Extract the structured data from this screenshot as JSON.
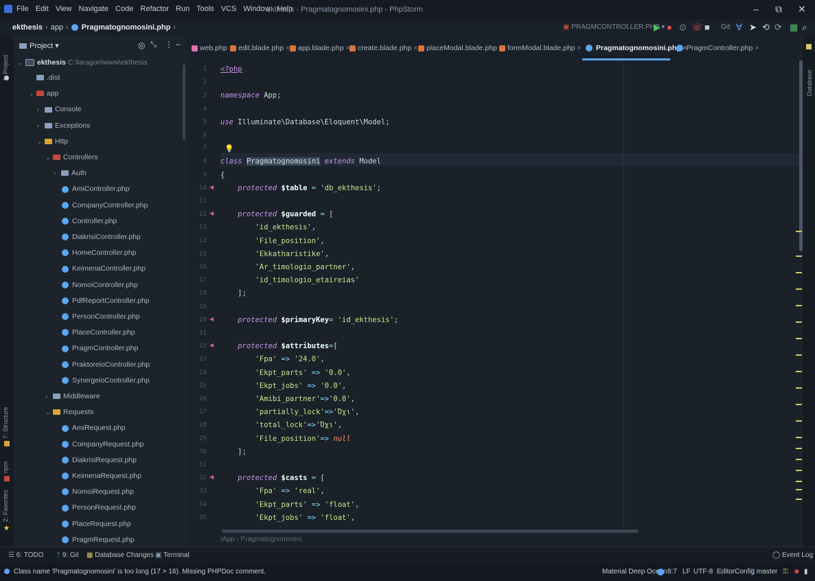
{
  "menu": {
    "items": [
      "File",
      "Edit",
      "View",
      "Navigate",
      "Code",
      "Refactor",
      "Run",
      "Tools",
      "VCS",
      "Window",
      "Help"
    ],
    "window_title": "ekthesis - Pragmatognomosini.php - PhpStorm"
  },
  "breadcrumb": {
    "project": "ekthesis",
    "folder": "app",
    "file": "Pragmatognomosini.php"
  },
  "run_config": "PRAGMCONTROLLER.PHP",
  "toolbar_vcs": "Git:",
  "project_panel": {
    "title": "Project",
    "root": "ekthesis",
    "root_path": "C:\\laragon\\www\\ekthesis",
    "items": [
      {
        "label": ".dist",
        "depth": 1
      },
      {
        "label": "app",
        "depth": 1
      },
      {
        "label": "Console",
        "depth": 2
      },
      {
        "label": "Exceptions",
        "depth": 2
      },
      {
        "label": "Http",
        "depth": 2
      },
      {
        "label": "Controllers",
        "depth": 3
      },
      {
        "label": "Auth",
        "depth": 4
      },
      {
        "label": "AmiController.php",
        "depth": 5
      },
      {
        "label": "CompanyController.php",
        "depth": 5
      },
      {
        "label": "Controller.php",
        "depth": 5
      },
      {
        "label": "DiakrisiController.php",
        "depth": 5
      },
      {
        "label": "HomeController.php",
        "depth": 5
      },
      {
        "label": "KeimenaController.php",
        "depth": 5
      },
      {
        "label": "NomoiController.php",
        "depth": 5
      },
      {
        "label": "PdfReportController.php",
        "depth": 5
      },
      {
        "label": "PersonController.php",
        "depth": 5
      },
      {
        "label": "PlaceController.php",
        "depth": 5
      },
      {
        "label": "PragmController.php",
        "depth": 5
      },
      {
        "label": "PraktoreioController.php",
        "depth": 5
      },
      {
        "label": "SynergeioController.php",
        "depth": 5
      },
      {
        "label": "Middleware",
        "depth": 3
      },
      {
        "label": "Requests",
        "depth": 3
      },
      {
        "label": "AmiRequest.php",
        "depth": 5
      },
      {
        "label": "CompanyRequest.php",
        "depth": 5
      },
      {
        "label": "DiakrisiRequest.php",
        "depth": 5
      },
      {
        "label": "KeimenaRequest.php",
        "depth": 5
      },
      {
        "label": "NomoiRequest.php",
        "depth": 5
      },
      {
        "label": "PersonRequest.php",
        "depth": 5
      },
      {
        "label": "PlaceRequest.php",
        "depth": 5
      },
      {
        "label": "PragmRequest.php",
        "depth": 5
      }
    ]
  },
  "tabs": [
    {
      "label": "web.php",
      "active": false
    },
    {
      "label": "edit.blade.php",
      "active": false
    },
    {
      "label": "app.blade.php",
      "active": false
    },
    {
      "label": "create.blade.php",
      "active": false
    },
    {
      "label": "placeModal.blade.php",
      "active": false
    },
    {
      "label": "formModal.blade.php",
      "active": false
    },
    {
      "label": "Pragmatognomosini.php",
      "active": true
    },
    {
      "label": "PragmController.php",
      "active": false
    }
  ],
  "code_lines": [
    "<?php",
    "",
    "namespace App;",
    "",
    "use Illuminate\\Database\\Eloquent\\Model;",
    "",
    "",
    "class Pragmatognomosini extends Model",
    "{",
    "    protected $table = 'db_ekthesis';",
    "",
    "    protected $guarded = [",
    "        'id_ekthesis',",
    "        'File_position',",
    "        'Ekkatharistike',",
    "        'Ar_timologio_partner',",
    "        'id_timologio_etaireias'",
    "    ];",
    "",
    "    protected $primaryKey= 'id_ekthesis';",
    "",
    "    protected $attributes=[",
    "        'Fpa' => '24.0',",
    "        'Ekpt_parts' => '0.0',",
    "        'Ekpt_jobs' => '0.0',",
    "        'Amibi_partner'=>'0.0',",
    "        'partially_lock'=>'Όχι',",
    "        'total_lock'=>'Όχι',",
    "        'File_position'=> null",
    "    ];",
    "",
    "    protected $casts = [",
    "        'Fpa' => 'real',",
    "        'Ekpt_parts' => 'float',",
    "        'Ekpt_jobs' => 'float',"
  ],
  "editor_breadcrumb": "\\App  ›  Pragmatognomosini",
  "left_tool_windows": [
    "1: Project",
    "7: Structure",
    "npm",
    "2: Favorites"
  ],
  "right_tool_windows": [
    "Database"
  ],
  "bottom_tools": [
    "6: TODO",
    "9: Git",
    "Database Changes",
    "Terminal"
  ],
  "event_log": "Event Log",
  "status": {
    "message": "Class name 'Pragmatognomosini' is too long (17 > 16). Missing PHPDoc comment.",
    "theme": "Material Deep Ocean",
    "position": "8:7",
    "line_sep": "LF",
    "encoding": "UTF-8",
    "editorconfig": "EditorConfig",
    "branch": "master"
  },
  "colors": {
    "accent": "#5aa6f0",
    "background": "#1b2129",
    "keyword": "#c792ea",
    "string": "#c3e88d"
  }
}
